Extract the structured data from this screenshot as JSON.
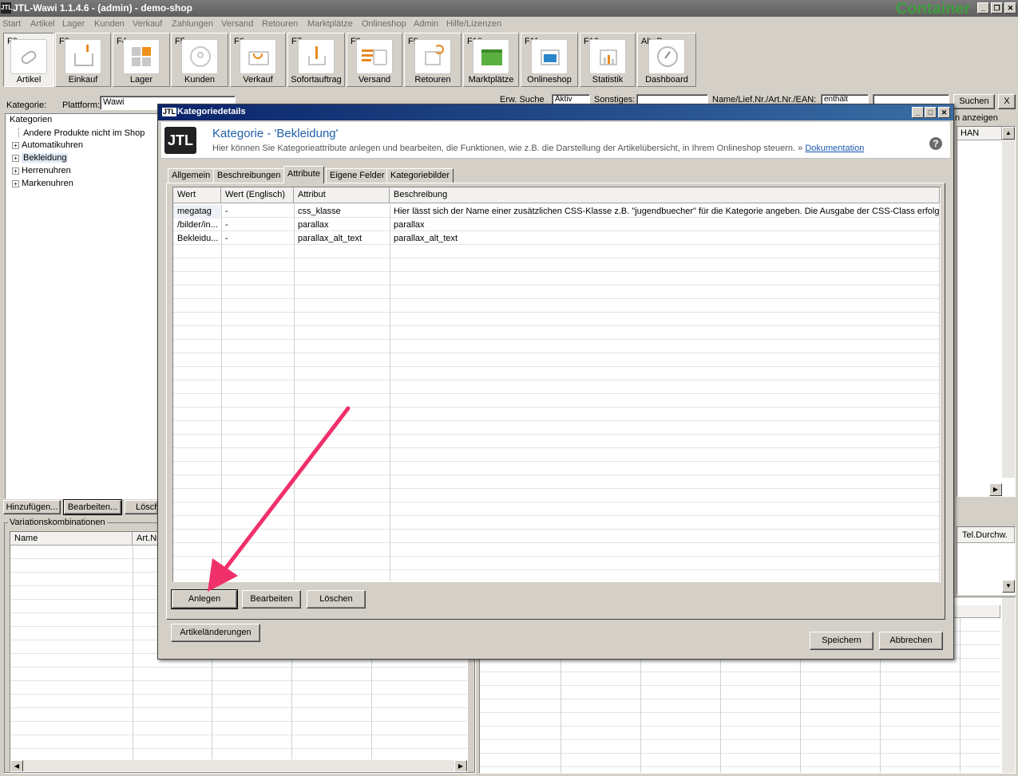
{
  "window": {
    "title": "JTL-Wawi 1.1.4.6 - (admin) - demo-shop",
    "logo": "JTL",
    "overlay_text": "Container"
  },
  "menu": [
    "Start",
    "Artikel",
    "Lager",
    "Kunden",
    "Verkauf",
    "Zahlungen",
    "Versand",
    "Retouren",
    "Marktplätze",
    "Onlineshop",
    "Admin",
    "Hilfe/Lizenzen"
  ],
  "toolbar": [
    {
      "key": "F2",
      "label": "Artikel",
      "icon": "tag-icon"
    },
    {
      "key": "F3",
      "label": "Einkauf",
      "icon": "inbox-icon"
    },
    {
      "key": "F4",
      "label": "Lager",
      "icon": "boxes-icon"
    },
    {
      "key": "F5",
      "label": "Kunden",
      "icon": "customer-icon"
    },
    {
      "key": "F6",
      "label": "Verkauf",
      "icon": "cart-icon"
    },
    {
      "key": "F7",
      "label": "Sofortauftrag",
      "icon": "upload-icon"
    },
    {
      "key": "F8",
      "label": "Versand",
      "icon": "shipping-icon"
    },
    {
      "key": "F9",
      "label": "Retouren",
      "icon": "return-icon"
    },
    {
      "key": "F10",
      "label": "Marktplätze",
      "icon": "marketplace-icon"
    },
    {
      "key": "F11",
      "label": "Onlineshop",
      "icon": "onlineshop-icon"
    },
    {
      "key": "F12",
      "label": "Statistik",
      "icon": "chart-icon"
    },
    {
      "key": "Alt+D",
      "label": "Dashboard",
      "icon": "dashboard-icon"
    }
  ],
  "filters": {
    "kategorie_label": "Kategorie:",
    "plattform_label": "Plattform:",
    "plattform_value": "Wawi",
    "erw_suche": "Erw. Suche",
    "aktiv_value": "Aktiv",
    "sonstiges_label": "Sonstiges:",
    "name_label": "Name/Lief.Nr./Art.Nr./EAN:",
    "enthaelt_value": "enthält",
    "suchen_label": "Suchen",
    "clear_label": "X",
    "anzeigen_text": "n anzeigen"
  },
  "tree": {
    "root": "Kategorien",
    "items": [
      "Andere Produkte nicht im Shop",
      "Automatikuhren",
      "Bekleidung",
      "Herrenuhren",
      "Markenuhren"
    ]
  },
  "left_buttons": {
    "add": "Hinzufügen...",
    "edit": "Bearbeiten...",
    "delete": "Lösch"
  },
  "variations": {
    "title": "Variationskombinationen",
    "columns": [
      "Name",
      "Art.Nr"
    ]
  },
  "right_grid": {
    "col_han": "HAN",
    "col_tel": "Tel.Durchw."
  },
  "dialog": {
    "title": "Kategoriedetails",
    "heading": "Kategorie - 'Bekleidung'",
    "description": "Hier können Sie Kategorieattribute anlegen und bearbeiten, die Funktionen, wie z.B. die Darstellung der Artikelübersicht, in Ihrem Onlineshop steuern. »",
    "doc_link": "Dokumentation",
    "tabs": [
      "Allgemein",
      "Beschreibungen",
      "Attribute",
      "Eigene Felder",
      "Kategoriebilder"
    ],
    "active_tab": "Attribute",
    "columns": [
      "Wert",
      "Wert (Englisch)",
      "Attribut",
      "Beschreibung"
    ],
    "rows": [
      {
        "wert": "megatag",
        "wert_en": "-",
        "attribut": "css_klasse",
        "beschreibung": "Hier lässt sich der Name einer zusätzlichen CSS-Klasse z.B. \"jugendbuecher\" für die Kategorie angeben. Die Ausgabe der CSS-Class erfolgt im..."
      },
      {
        "wert": "/bilder/in...",
        "wert_en": "-",
        "attribut": "parallax",
        "beschreibung": "parallax"
      },
      {
        "wert": "Bekleidu...",
        "wert_en": "-",
        "attribut": "parallax_alt_text",
        "beschreibung": "parallax_alt_text"
      }
    ],
    "buttons": {
      "create": "Anlegen",
      "edit": "Bearbeiten",
      "delete": "Löschen",
      "changes": "Artikeländerungen",
      "save": "Speichern",
      "cancel": "Abbrechen"
    }
  },
  "accent": {
    "arrow": "#f0306a",
    "titlebar": "#0a246a",
    "link": "#1a56b0"
  }
}
